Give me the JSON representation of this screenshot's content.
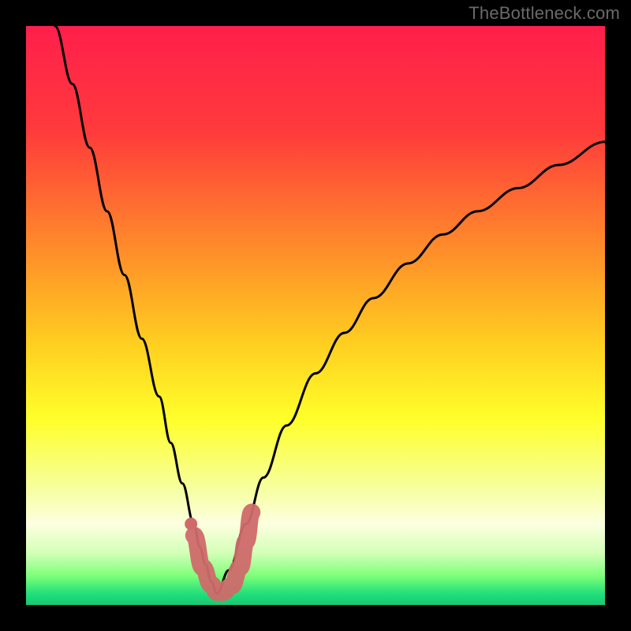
{
  "watermark": "TheBottleneck.com",
  "chart_data": {
    "type": "line",
    "title": "",
    "xlabel": "",
    "ylabel": "",
    "x_range": [
      0,
      100
    ],
    "y_range": [
      0,
      100
    ],
    "minimum_x": 33,
    "gradient_stops": [
      {
        "pct": 0,
        "color": "#ff1f4b"
      },
      {
        "pct": 18,
        "color": "#ff3a3c"
      },
      {
        "pct": 38,
        "color": "#ff8a2a"
      },
      {
        "pct": 55,
        "color": "#ffcf20"
      },
      {
        "pct": 68,
        "color": "#ffff2a"
      },
      {
        "pct": 80,
        "color": "#f6ffa0"
      },
      {
        "pct": 86,
        "color": "#fdffe0"
      },
      {
        "pct": 91,
        "color": "#d3ffb8"
      },
      {
        "pct": 95,
        "color": "#7dff79"
      },
      {
        "pct": 98,
        "color": "#22e07a"
      },
      {
        "pct": 100,
        "color": "#18c873"
      }
    ],
    "series": [
      {
        "name": "left-branch",
        "x": [
          5,
          8,
          11,
          14,
          17,
          20,
          23,
          25,
          27,
          29,
          30,
          31,
          32,
          33
        ],
        "y": [
          100,
          90,
          79,
          68,
          57,
          46,
          36,
          28,
          21,
          14,
          10,
          7,
          4,
          2
        ]
      },
      {
        "name": "right-branch",
        "x": [
          33,
          35,
          38,
          41,
          45,
          50,
          55,
          60,
          66,
          72,
          78,
          85,
          92,
          100
        ],
        "y": [
          2,
          6,
          14,
          22,
          31,
          40,
          47,
          53,
          59,
          64,
          68,
          72,
          76,
          80
        ]
      }
    ],
    "highlight_band": {
      "name": "optimal-zone",
      "color": "#cf6a6a",
      "points_x": [
        29,
        30.5,
        32,
        33,
        34,
        35.5,
        37,
        38,
        39
      ],
      "points_y": [
        12,
        6.5,
        3.5,
        2.2,
        2.2,
        3.3,
        6.5,
        11,
        16
      ]
    },
    "highlight_dot": {
      "x": 28.5,
      "y": 14,
      "color": "#cf6a6a"
    }
  }
}
